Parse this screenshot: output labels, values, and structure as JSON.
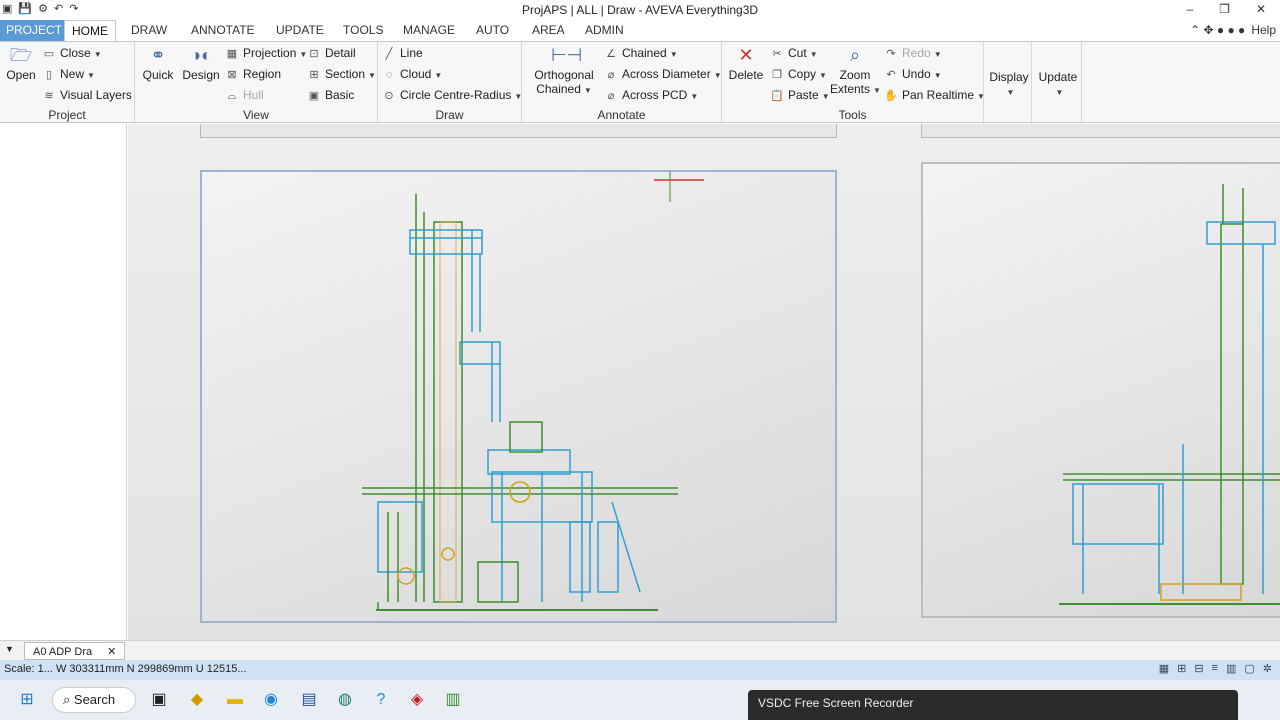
{
  "window": {
    "title": "ProjAPS | ALL | Draw - AVEVA Everything3D",
    "controls": [
      "–",
      "❐",
      "✕"
    ]
  },
  "tabs": {
    "project": "PROJECT",
    "items": [
      "HOME",
      "DRAW",
      "ANNOTATE",
      "UPDATE",
      "TOOLS",
      "MANAGE",
      "AUTO",
      "AREA",
      "ADMIN"
    ],
    "help": "Help"
  },
  "ribbon": {
    "project": {
      "label": "Project",
      "open": "Open",
      "close": "Close",
      "new": "New",
      "visual_layers": "Visual Layers"
    },
    "view": {
      "label": "View",
      "quick": "Quick",
      "design": "Design",
      "projection": "Projection",
      "region": "Region",
      "hull": "Hull",
      "detail": "Detail",
      "section": "Section",
      "basic": "Basic"
    },
    "draw": {
      "label": "Draw",
      "line": "Line",
      "cloud": "Cloud",
      "circle": "Circle Centre-Radius"
    },
    "annotate": {
      "label": "Annotate",
      "orthogonal": "Orthogonal",
      "chained_big": "Chained",
      "chained": "Chained",
      "across_diameter": "Across Diameter",
      "across_pcd": "Across PCD"
    },
    "tools": {
      "label": "Tools",
      "delete": "Delete",
      "cut": "Cut",
      "copy": "Copy",
      "paste": "Paste",
      "zoom": "Zoom",
      "extents": "Extents",
      "redo": "Redo",
      "undo": "Undo",
      "pan_realtime": "Pan Realtime"
    },
    "display": "Display",
    "update": "Update"
  },
  "doc_tab": {
    "label": "A0 ADP Dra",
    "close": "✕"
  },
  "status": {
    "text": "Scale: 1...  W 303311mm N 299869mm U 12515..."
  },
  "taskbar": {
    "search": "Search"
  },
  "recorder": {
    "title": "VSDC Free Screen Recorder"
  },
  "colors": {
    "accent": "#5b9bd5",
    "pipe_green": "#3c8f2a",
    "steel_blue": "#2f9fd0",
    "equip_yellow": "#d4a017"
  }
}
